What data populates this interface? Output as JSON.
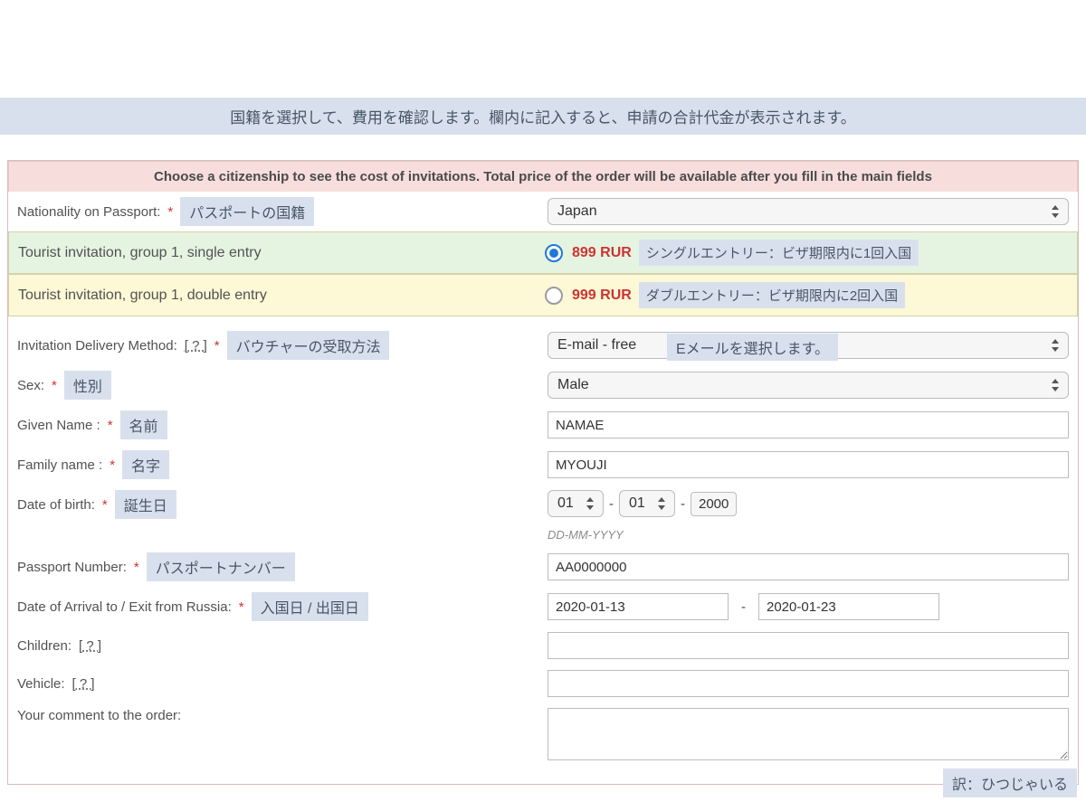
{
  "top_banner": "国籍を選択して、費用を確認します。欄内に記入すると、申請の合計代金が表示されます。",
  "notice": "Choose a citizenship to see the cost of invitations. Total price of the order will be available after you fill in the main fields",
  "nationality": {
    "label": "Nationality on Passport:",
    "tag": "パスポートの国籍",
    "value": "Japan"
  },
  "options": [
    {
      "label": "Tourist invitation, group 1, single entry",
      "price": "899 RUR",
      "tag": "シングルエントリー：ビザ期限内に1回入国",
      "checked": true
    },
    {
      "label": "Tourist invitation, group 1, double entry",
      "price": "999 RUR",
      "tag": "ダブルエントリー：ビザ期限内に2回入国",
      "checked": false
    }
  ],
  "delivery": {
    "label": "Invitation Delivery Method:",
    "help": "[ ? ]",
    "tag": "バウチャーの受取方法",
    "value": "E-mail - free",
    "overlay": "Eメールを選択します。"
  },
  "sex": {
    "label": "Sex:",
    "tag": "性別",
    "value": "Male"
  },
  "given": {
    "label": "Given Name :",
    "tag": "名前",
    "value": "NAMAE"
  },
  "family": {
    "label": "Family name :",
    "tag": "名字",
    "value": "MYOUJI"
  },
  "dob": {
    "label": "Date of birth:",
    "tag": "誕生日",
    "day": "01",
    "month": "01",
    "year": "2000",
    "hint": "DD-MM-YYYY"
  },
  "passport": {
    "label": "Passport Number:",
    "tag": "パスポートナンバー",
    "value": "AA0000000"
  },
  "travel": {
    "label": "Date of Arrival to / Exit from Russia:",
    "tag": "入国日 / 出国日",
    "arrival": "2020-01-13",
    "exit": "2020-01-23"
  },
  "children": {
    "label": "Children:",
    "help": "[ ? ]"
  },
  "vehicle": {
    "label": "Vehicle:",
    "help": "[ ? ]"
  },
  "comment": {
    "label": "Your comment to the order:"
  },
  "corner": "訳：ひつじゃいる",
  "asterisk": "*"
}
